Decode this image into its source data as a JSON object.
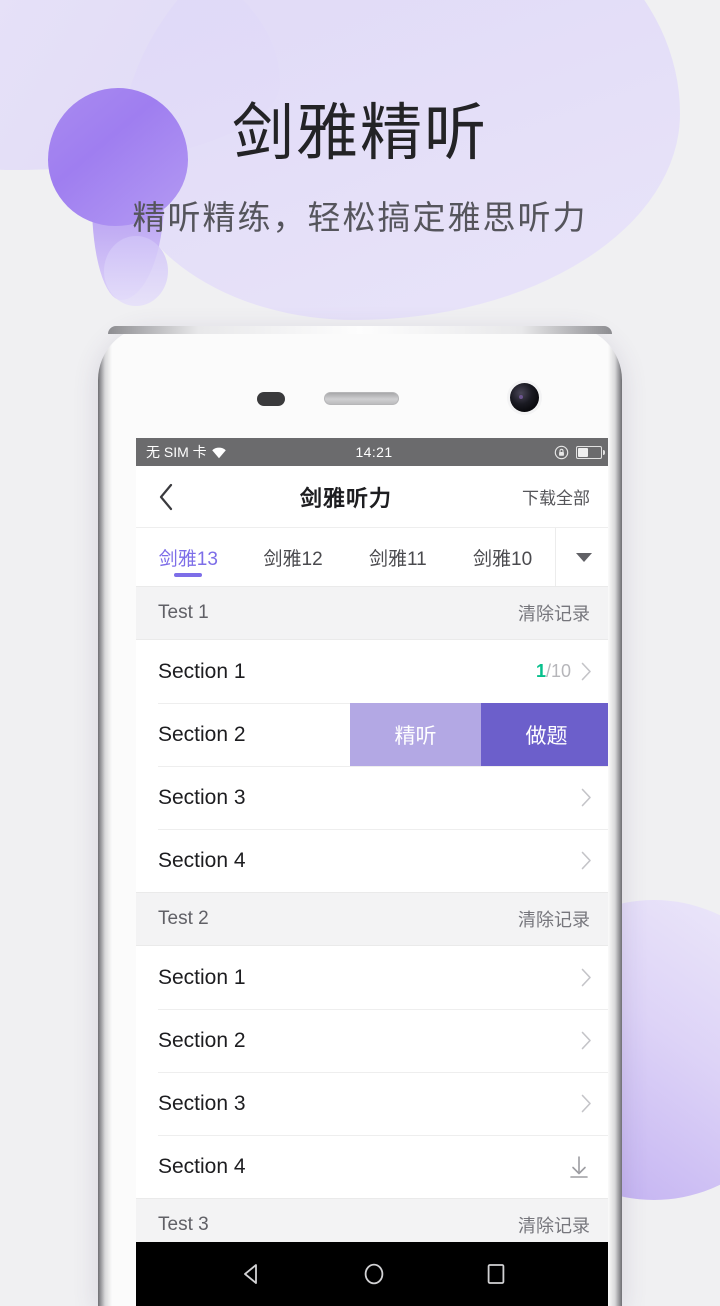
{
  "hero": {
    "title": "剑雅精听",
    "subtitle": "精听精练，轻松搞定雅思听力"
  },
  "colors": {
    "accent_purple": "#7d6ee8",
    "swipe_listen": "#b3a8e4",
    "swipe_quiz": "#6c5fcb",
    "progress_green": "#07c08c",
    "page_background": "#f0f0f2"
  },
  "status_bar": {
    "carrier": "无 SIM 卡",
    "wifi_icon": "wifi-icon",
    "time": "14:21",
    "rotation_lock_icon": "rotation-lock-icon",
    "battery_icon": "battery-icon",
    "battery_level_percent": 42
  },
  "header": {
    "back_icon": "back-chevron-icon",
    "title": "剑雅听力",
    "download_all_label": "下载全部"
  },
  "tabs": {
    "items": [
      {
        "label": "剑雅13",
        "active": true
      },
      {
        "label": "剑雅12",
        "active": false
      },
      {
        "label": "剑雅11",
        "active": false
      },
      {
        "label": "剑雅10",
        "active": false
      }
    ],
    "expand_icon": "chevron-down-icon"
  },
  "list": {
    "groups": [
      {
        "title": "Test 1",
        "clear_label": "清除记录",
        "rows": [
          {
            "label": "Section 1",
            "progress_done": "1",
            "progress_total": "/10",
            "accessory": "chevron"
          },
          {
            "label": "Section 2",
            "accessory": "swipe-actions",
            "actions": [
              {
                "label": "精听",
                "style": "listen"
              },
              {
                "label": "做题",
                "style": "quiz"
              }
            ]
          },
          {
            "label": "Section 3",
            "accessory": "chevron"
          },
          {
            "label": "Section 4",
            "accessory": "chevron"
          }
        ]
      },
      {
        "title": "Test 2",
        "clear_label": "清除记录",
        "rows": [
          {
            "label": "Section 1",
            "accessory": "chevron"
          },
          {
            "label": "Section 2",
            "accessory": "chevron"
          },
          {
            "label": "Section 3",
            "accessory": "chevron"
          },
          {
            "label": "Section 4",
            "accessory": "download"
          }
        ]
      },
      {
        "title": "Test 3",
        "clear_label": "清除记录",
        "rows": []
      }
    ]
  },
  "android_nav": {
    "back_icon": "android-back-icon",
    "home_icon": "android-home-icon",
    "recents_icon": "android-recents-icon"
  }
}
